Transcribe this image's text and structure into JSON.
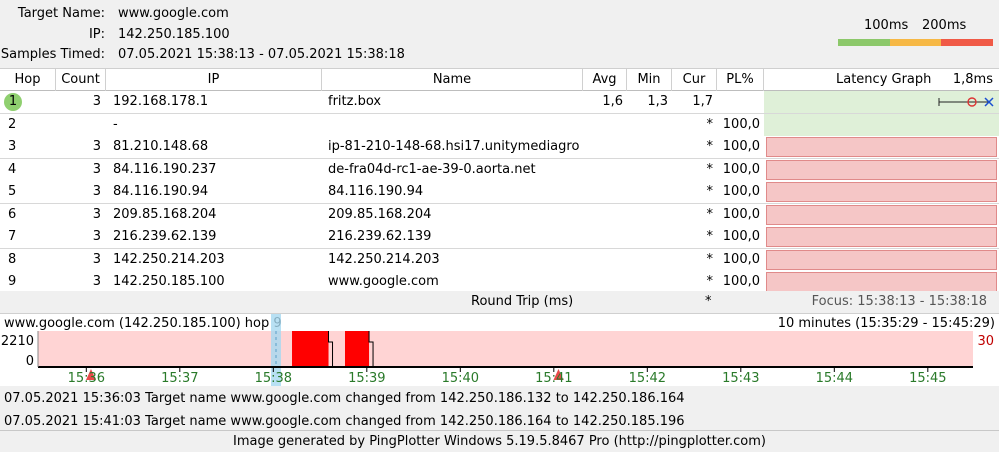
{
  "header": {
    "target_label": "Target Name:",
    "target_value": "www.google.com",
    "ip_label": "IP:",
    "ip_value": "142.250.185.100",
    "samples_label": "Samples Timed:",
    "samples_value": "07.05.2021 15:38:13 - 07.05.2021 15:38:18",
    "legend_100": "100ms",
    "legend_200": "200ms",
    "legend_colors": [
      "#8cc86a",
      "#f6b845",
      "#f05a47"
    ]
  },
  "table": {
    "columns": {
      "hop": "Hop",
      "count": "Count",
      "ip": "IP",
      "name": "Name",
      "avg": "Avg",
      "min": "Min",
      "cur": "Cur",
      "pl": "PL%",
      "graph": "Latency Graph",
      "graph_max": "1,8ms"
    },
    "rows": [
      {
        "hop": "1",
        "count": "3",
        "ip": "192.168.178.1",
        "name": "fritz.box",
        "avg": "1,6",
        "min": "1,3",
        "cur": "1,7",
        "pl": "",
        "status": "ok"
      },
      {
        "hop": "2",
        "count": "",
        "ip": "-",
        "name": "",
        "avg": "",
        "min": "",
        "cur": "*",
        "pl": "100,0",
        "status": "ok"
      },
      {
        "hop": "3",
        "count": "3",
        "ip": "81.210.148.68",
        "name": "ip-81-210-148-68.hsi17.unitymediagro",
        "avg": "",
        "min": "",
        "cur": "*",
        "pl": "100,0",
        "status": "loss"
      },
      {
        "hop": "4",
        "count": "3",
        "ip": "84.116.190.237",
        "name": "de-fra04d-rc1-ae-39-0.aorta.net",
        "avg": "",
        "min": "",
        "cur": "*",
        "pl": "100,0",
        "status": "loss"
      },
      {
        "hop": "5",
        "count": "3",
        "ip": "84.116.190.94",
        "name": "84.116.190.94",
        "avg": "",
        "min": "",
        "cur": "*",
        "pl": "100,0",
        "status": "loss"
      },
      {
        "hop": "6",
        "count": "3",
        "ip": "209.85.168.204",
        "name": "209.85.168.204",
        "avg": "",
        "min": "",
        "cur": "*",
        "pl": "100,0",
        "status": "loss"
      },
      {
        "hop": "7",
        "count": "3",
        "ip": "216.239.62.139",
        "name": "216.239.62.139",
        "avg": "",
        "min": "",
        "cur": "*",
        "pl": "100,0",
        "status": "loss"
      },
      {
        "hop": "8",
        "count": "3",
        "ip": "142.250.214.203",
        "name": "142.250.214.203",
        "avg": "",
        "min": "",
        "cur": "*",
        "pl": "100,0",
        "status": "loss"
      },
      {
        "hop": "9",
        "count": "3",
        "ip": "142.250.185.100",
        "name": "www.google.com",
        "avg": "",
        "min": "",
        "cur": "*",
        "pl": "100,0",
        "status": "loss"
      }
    ]
  },
  "roundtrip": {
    "label": "Round Trip (ms)",
    "cur": "*",
    "focus": "Focus: 15:38:13 - 15:38:18"
  },
  "timegraph": {
    "title": "www.google.com (142.250.185.100) hop 9",
    "range": "10 minutes (15:35:29 - 15:45:29)",
    "y_max": "2210",
    "y_min": "0",
    "right_label": "30",
    "x_ticks": [
      "15:36",
      "15:37",
      "15:38",
      "15:39",
      "15:40",
      "15:41",
      "15:42",
      "15:43",
      "15:44",
      "15:45"
    ],
    "loss_blocks": [
      "15:38:12-15:38:38",
      "15:38:46-15:39:04"
    ],
    "event_markers": [
      "15:36:03",
      "15:41:03"
    ],
    "colors": {
      "bg_loss": "#ffd4d4",
      "loss": "#ff0000",
      "tick": "#2a7a2a",
      "focus": "#a6d8f0"
    }
  },
  "events": [
    "07.05.2021 15:36:03 Target name www.google.com changed from 142.250.186.132 to 142.250.186.164",
    "07.05.2021 15:41:03 Target name www.google.com changed from 142.250.186.164 to 142.250.185.196"
  ],
  "footer": "Image generated by PingPlotter Windows 5.19.5.8467 Pro (http://pingplotter.com)"
}
